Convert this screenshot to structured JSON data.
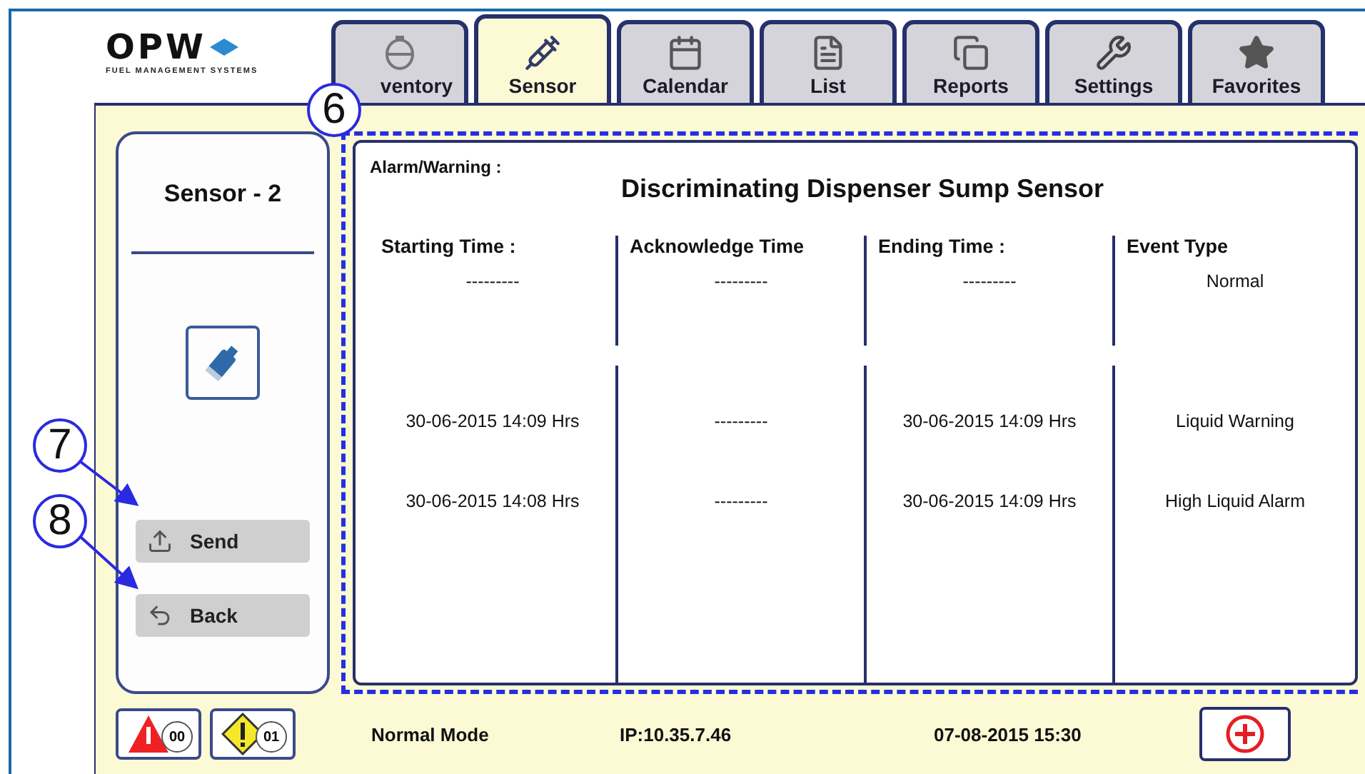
{
  "logo": {
    "name": "OPW",
    "tagline": "FUEL MANAGEMENT SYSTEMS"
  },
  "tabs": [
    {
      "label": "ventory",
      "kind": "tank",
      "selected": false
    },
    {
      "label": "Sensor",
      "kind": "probe",
      "selected": true
    },
    {
      "label": "Calendar",
      "kind": "calendar",
      "selected": false
    },
    {
      "label": "List",
      "kind": "list",
      "selected": false
    },
    {
      "label": "Reports",
      "kind": "reports",
      "selected": false
    },
    {
      "label": "Settings",
      "kind": "tools",
      "selected": false
    },
    {
      "label": "Favorites",
      "kind": "star",
      "selected": false
    }
  ],
  "side_panel": {
    "title": "Sensor - 2",
    "buttons": [
      {
        "label": "Send",
        "kind": "upload"
      },
      {
        "label": "Back",
        "kind": "back"
      }
    ]
  },
  "event_panel": {
    "label": "Alarm/Warning :",
    "title": "Discriminating Dispenser Sump Sensor",
    "columns": [
      {
        "label": "Starting Time :",
        "value": "---------"
      },
      {
        "label": "Acknowledge Time",
        "value": "---------"
      },
      {
        "label": "Ending Time :",
        "value": "---------"
      },
      {
        "label": "Event Type",
        "value": "Normal"
      }
    ],
    "rows": [
      [
        "30-06-2015 14:09 Hrs",
        "---------",
        "30-06-2015 14:09 Hrs",
        "Liquid Warning"
      ],
      [
        "30-06-2015 14:08 Hrs",
        "---------",
        "30-06-2015 14:09 Hrs",
        "High Liquid Alarm"
      ]
    ]
  },
  "status_bar": {
    "alarms": [
      {
        "kind": "alarm",
        "count": "00"
      },
      {
        "kind": "warning",
        "count": "01"
      }
    ],
    "mode": "Normal Mode",
    "ip": "IP:10.35.7.46",
    "datetime": "07-08-2015 15:30"
  },
  "callouts": [
    {
      "label": "6"
    },
    {
      "label": "7"
    },
    {
      "label": "8"
    }
  ]
}
